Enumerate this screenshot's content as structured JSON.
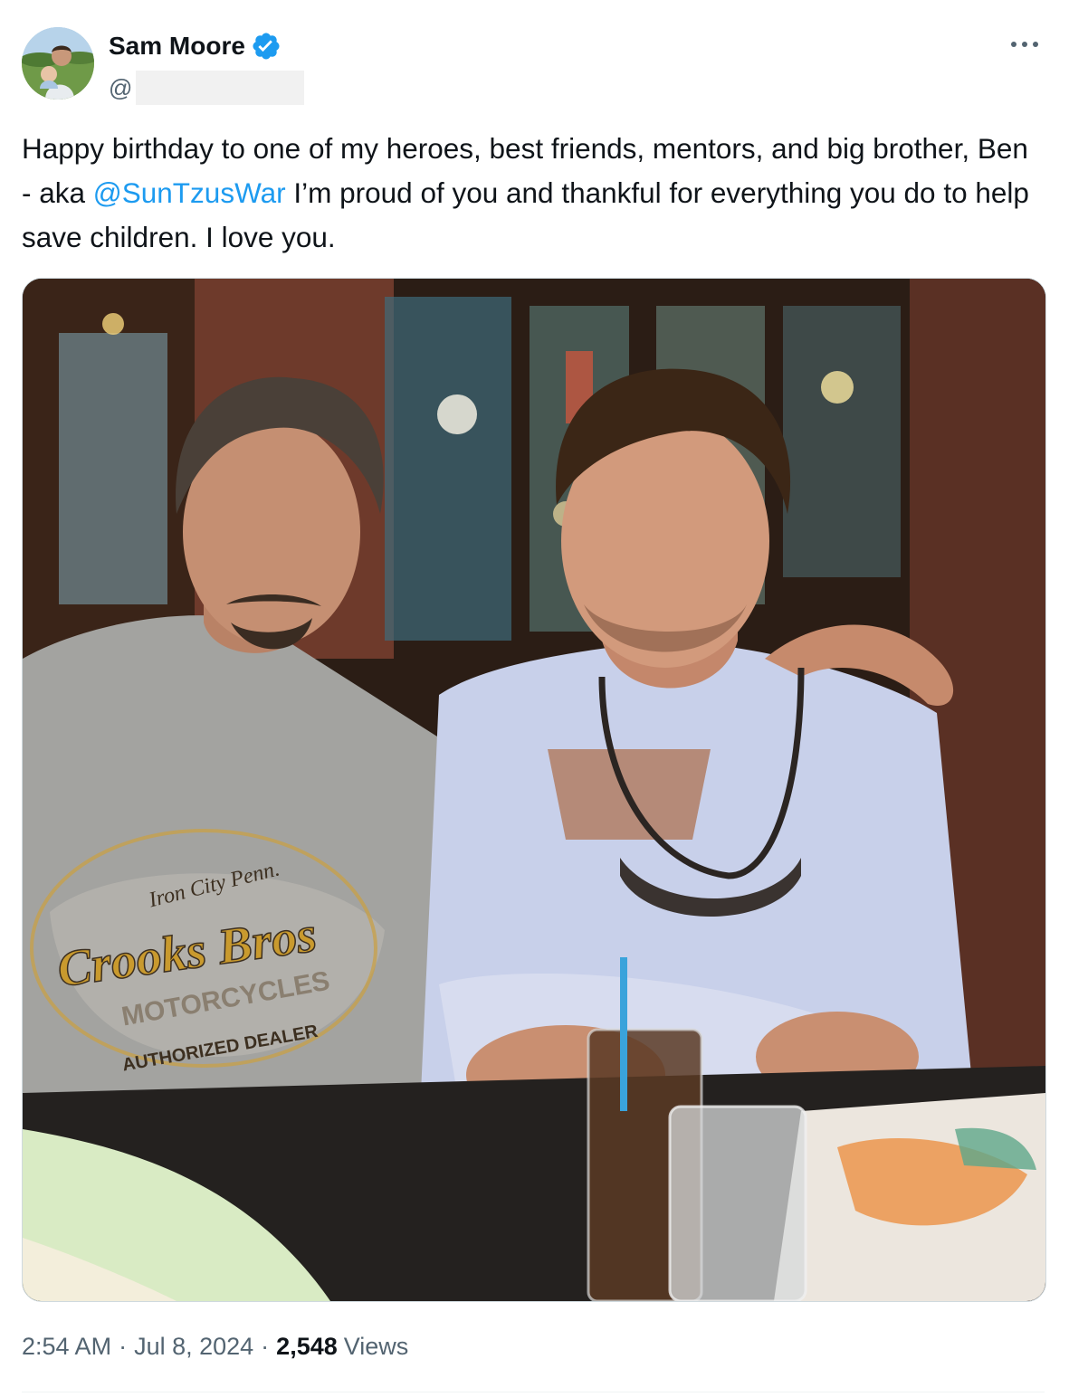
{
  "author": {
    "display_name": "Sam Moore",
    "handle_prefix": "@",
    "verified": true,
    "verified_color": "#1d9bf0"
  },
  "menu": {
    "icon": "more-horizontal-icon"
  },
  "tweet": {
    "text_before": "Happy birthday to one of my heroes, best friends, mentors, and big brother, Ben - aka ",
    "mention": "@SunTzusWar",
    "text_after": " I’m proud of you and thankful for everything you do to help save children. I love you.",
    "mention_color": "#1d9bf0"
  },
  "media": {
    "shirt_text_top": "Iron City Penn.",
    "shirt_text_main": "Crooks Bros",
    "shirt_text_sub": "MOTORCYCLES",
    "shirt_text_bottom": "AUTHORIZED DEALER"
  },
  "meta": {
    "time": "2:54 AM",
    "separator": "·",
    "date": "Jul 8, 2024",
    "views_count": "2,548",
    "views_label": "Views"
  }
}
